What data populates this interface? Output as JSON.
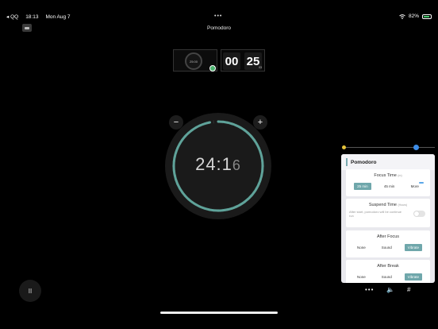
{
  "status": {
    "back_app": "◂ QQ",
    "time": "18:13",
    "date": "Mon Aug 7",
    "dots": "•••",
    "battery_percent": "82%"
  },
  "header": {
    "title": "Pomodoro"
  },
  "mini_clock": {
    "label": "25:00"
  },
  "flip_clock": {
    "minutes": "00",
    "seconds": "25",
    "sub": "03"
  },
  "timer": {
    "display": "24:1",
    "flip_digit": "6",
    "minus_label": "−",
    "plus_label": "+",
    "progress_fraction": 0.97
  },
  "slider": {
    "level": 0.8
  },
  "panel": {
    "title": "Pomodoro",
    "focus_time": {
      "title": "Focus Time",
      "hint": "(m)",
      "options": [
        "25 min",
        "45 min",
        "More"
      ],
      "selected": 0
    },
    "suspend_time": {
      "title": "Suspend Time",
      "hint": "(Hours)",
      "desc": "After start, pomodoro will be continue run",
      "enabled": false
    },
    "after_focus": {
      "title": "After Focus",
      "options": [
        "None",
        "Sound",
        "Vibrate"
      ],
      "selected": 2
    },
    "after_break": {
      "title": "After Break",
      "options": [
        "None",
        "Sound",
        "Vibrate"
      ],
      "selected": 2
    }
  },
  "controls": {
    "pause_glyph": "II",
    "more_glyph": "•••",
    "speaker_glyph": "🔈",
    "grid_glyph": "#"
  },
  "colors": {
    "accent_teal": "#6fa7ab",
    "clock_teal": "#5fa39a",
    "slider_blue": "#3d8de8",
    "check_green": "#4bb36f"
  }
}
